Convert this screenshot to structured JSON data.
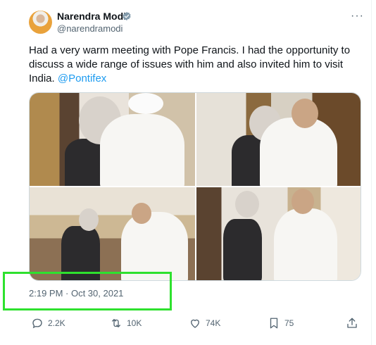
{
  "author": {
    "name": "Narendra Modi",
    "handle": "@narendramodi",
    "verified": true
  },
  "post": {
    "text": "Had a very warm meeting with Pope Francis. I had the opportunity to discuss a wide range of issues with him and also invited him to visit India.",
    "mention": "@Pontifex",
    "timestamp": "2:19 PM · Oct 30, 2021"
  },
  "metrics": {
    "replies": "2.2K",
    "reposts": "10K",
    "likes": "74K",
    "bookmarks": "75"
  },
  "colors": {
    "highlight": "#2ee12e",
    "accent": "#1d9bf0",
    "verified": "#829aab"
  },
  "icons": [
    "more-icon",
    "verified-icon",
    "reply-icon",
    "repost-icon",
    "like-icon",
    "bookmark-icon",
    "share-icon"
  ]
}
